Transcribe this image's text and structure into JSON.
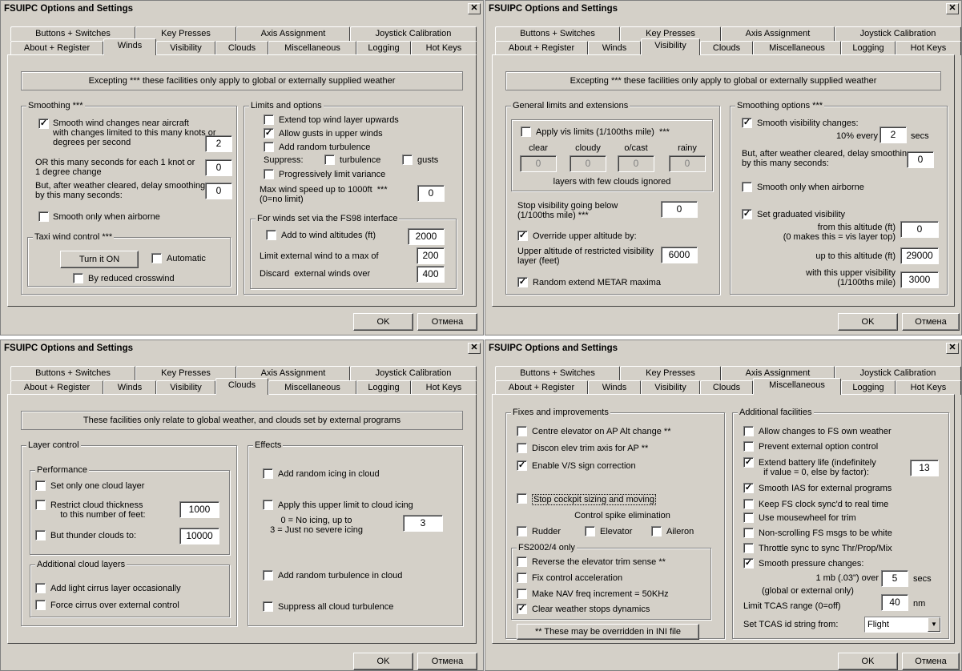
{
  "window_title": "FSUIPC Options and Settings",
  "close_glyph": "✕",
  "check_glyph": "✓",
  "ok_label": "OK",
  "cancel_label": "Отмена",
  "tabs_row1": [
    "Buttons + Switches",
    "Key Presses",
    "Axis Assignment",
    "Joystick Calibration"
  ],
  "tabs_row2": [
    "About + Register",
    "Winds",
    "Visibility",
    "Clouds",
    "Miscellaneous",
    "Logging",
    "Hot Keys"
  ],
  "winds": {
    "note": "Excepting *** these facilities only apply to global or externally supplied weather",
    "smoothing_title": "Smoothing ***",
    "smooth_changes": "Smooth wind changes near aircraft\nwith changes limited to this many knots or\ndegrees per second",
    "knots_value": "2",
    "or_seconds": "OR this many seconds for each 1 knot or\n1 degree change",
    "or_seconds_value": "0",
    "after_cleared": "But, after weather cleared, delay smoothing\nby this many seconds:",
    "delay_value": "0",
    "only_airborne": "Smooth only when airborne",
    "taxi_title": "Taxi wind control ***",
    "turn_on": "Turn it ON",
    "automatic": "Automatic",
    "crosswind": "By reduced crosswind",
    "limits_title": "Limits and options",
    "extend_top": "Extend top wind layer upwards",
    "allow_gusts": "Allow gusts in upper winds",
    "add_turbulence": "Add random turbulence",
    "suppress": "Suppress:",
    "turbulence": "turbulence",
    "gusts": "gusts",
    "prog_limit": "Progressively limit variance",
    "max_wind": "Max wind speed up to 1000ft  ***\n(0=no limit)",
    "max_wind_value": "0",
    "fs98_title": "For winds set via the FS98 interface",
    "add_alt": "Add to wind altitudes (ft)",
    "add_alt_value": "2000",
    "limit_ext": "Limit external wind to a max of",
    "limit_ext_value": "200",
    "discard": "Discard  external winds over",
    "discard_value": "400"
  },
  "visibility": {
    "note": "Excepting *** these facilities only apply to global or externally supplied weather",
    "general_title": "General limits and extensions",
    "apply_vis": "Apply vis limits (1/100ths mile)  ***",
    "col_clear": "clear",
    "col_cloudy": "cloudy",
    "col_ocast": "o/cast",
    "col_rainy": "rainy",
    "v_clear": "0",
    "v_cloudy": "0",
    "v_ocast": "0",
    "v_rainy": "0",
    "few_clouds": "layers with few clouds ignored",
    "stop_below": "Stop visibility going below\n(1/100ths mile) ***",
    "stop_value": "0",
    "override": "Override upper altitude by:",
    "upper_alt": "Upper altitude of restricted visibility\nlayer (feet)",
    "upper_alt_value": "6000",
    "random_metar": "Random extend METAR maxima",
    "smoothing_title": "Smoothing options ***",
    "smooth_vis": "Smooth visibility changes:",
    "pct_every": "10% every",
    "pct_value": "2",
    "secs": "secs",
    "after_cleared": "But, after weather cleared, delay smoothing\nby this many seconds:",
    "delay_value": "0",
    "only_airborne": "Smooth only when airborne",
    "graduated": "Set graduated visibility",
    "from_alt": "from this altitude (ft)\n(0 makes this = vis layer top)",
    "from_value": "0",
    "up_to": "up to this altitude (ft)",
    "up_to_value": "29000",
    "upper_vis": "with this upper visibility\n(1/100ths mile)",
    "upper_vis_value": "3000"
  },
  "clouds": {
    "note": "These facilities only relate to global weather, and clouds set by external programs",
    "layer_title": "Layer control",
    "perf_title": "Performance",
    "one_layer": "Set only one cloud layer",
    "restrict": "Restrict cloud thickness\n    to this number of feet:",
    "restrict_value": "1000",
    "thunder": "But thunder clouds to:",
    "thunder_value": "10000",
    "additional_title": "Additional cloud layers",
    "cirrus": "Add light cirrus layer occasionally",
    "force_cirrus": "Force cirrus over external control",
    "effects_title": "Effects",
    "icing": "Add random icing in cloud",
    "upper_icing": "Apply this upper limit to cloud icing",
    "icing_help": "0 = No icing, up to\n3 = Just no severe icing",
    "icing_value": "3",
    "rand_turb": "Add random turbulence in cloud",
    "suppress_turb": "Suppress all cloud turbulence"
  },
  "misc": {
    "fixes_title": "Fixes and improvements",
    "centre_elev": "Centre elevator on AP Alt change **",
    "discon_elev": "Discon elev trim axis for AP **",
    "vs_sign": "Enable V/S sign correction",
    "stop_cockpit": "Stop cockpit sizing and moving",
    "spike": "Control spike elimination",
    "rudder": "Rudder",
    "elevator": "Elevator",
    "aileron": "Aileron",
    "fs2002_title": "FS2002/4 only",
    "reverse_trim": "Reverse the elevator trim sense **",
    "fix_accel": "Fix control acceleration",
    "nav_freq": "Make NAV freq increment = 50KHz",
    "clear_dyn": "Clear weather stops dynamics",
    "overridden": "** These may be overridden in INI file",
    "additional_title": "Additional facilities",
    "allow_changes": "Allow changes to FS own weather",
    "prevent_ext": "Prevent external option control",
    "extend_battery": "Extend battery life (indefinitely\n  if value = 0, else by factor):",
    "battery_value": "13",
    "smooth_ias": "Smooth IAS for external programs",
    "keep_clock": "Keep FS clock sync'd to real time",
    "mousewheel": "Use mousewheel for trim",
    "nonscroll": "Non-scrolling FS msgs to be white",
    "throttle_sync": "Throttle sync to sync Thr/Prop/Mix",
    "smooth_pressure": "Smooth pressure changes:",
    "mb_over": "1 mb (.03\") over",
    "mb_value": "5",
    "mb_secs": "secs",
    "global_ext": "(global or external only)",
    "tcas_range": "Limit TCAS range (0=off)",
    "tcas_value": "40",
    "nm": "nm",
    "tcas_id": "Set TCAS id string from:",
    "tcas_id_value": "Flight",
    "dropdown_glyph": "▼"
  }
}
